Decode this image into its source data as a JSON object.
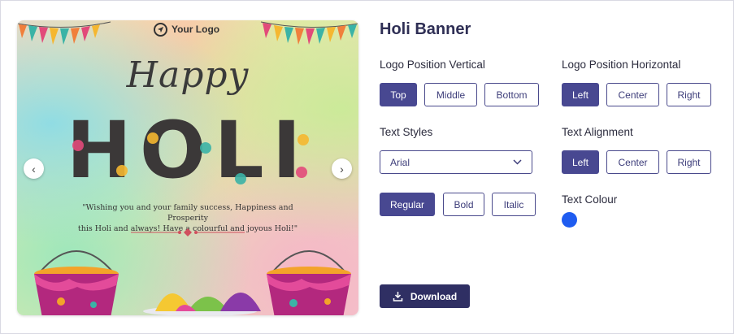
{
  "banner": {
    "logo_text": "Your Logo",
    "happy_text": "Happy",
    "holi_text": "HOLI",
    "quote_line1": "\"Wishing you and your family success, Happiness and Prosperity",
    "quote_line2": "this Holi and always! Have a colourful and joyous Holi!\""
  },
  "panel": {
    "title": "Holi Banner",
    "logo_vertical": {
      "label": "Logo Position Vertical",
      "options": [
        "Top",
        "Middle",
        "Bottom"
      ],
      "selected": "Top"
    },
    "logo_horizontal": {
      "label": "Logo Position Horizontal",
      "options": [
        "Left",
        "Center",
        "Right"
      ],
      "selected": "Left"
    },
    "text_styles": {
      "label": "Text Styles",
      "font_value": "Arial",
      "options": [
        "Regular",
        "Bold",
        "Italic"
      ],
      "selected": "Regular"
    },
    "text_alignment": {
      "label": "Text Alignment",
      "options": [
        "Left",
        "Center",
        "Right"
      ],
      "selected": "Left"
    },
    "text_colour": {
      "label": "Text Colour",
      "value": "#1f5cf0"
    },
    "download_label": "Download"
  },
  "colors": {
    "accent": "#484891",
    "download_bg": "#2f2f63",
    "text_colour_swatch": "#1f5cf0"
  },
  "icons": [
    "prev-arrow-icon",
    "next-arrow-icon",
    "chevron-down-icon",
    "download-icon",
    "logo-navigation-icon"
  ]
}
